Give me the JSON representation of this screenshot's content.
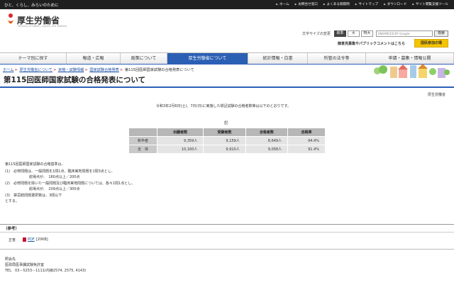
{
  "header": {
    "tagline": "ひと、くらし、みらいのために",
    "links": [
      "ホーム",
      "お問合せ窓口",
      "よくある御質問",
      "サイトマップ",
      "ダウンロード",
      "サイト閲覧支援ツール"
    ],
    "logo_title": "厚生労働省",
    "logo_sub": "Ministry of Health, Labour and Welfare",
    "fontsize_label": "文字サイズの変更",
    "fontsize_options": [
      "標準",
      "大",
      "特大"
    ],
    "search_placeholder": "ENHANCED BY Google",
    "search_button": "検索",
    "pubcomment": "御意見募集やパブリックコメントはこちら",
    "sankaku": "国民参加の場"
  },
  "nav": {
    "items": [
      "テーマ別に探す",
      "報道・広報",
      "政策について",
      "厚生労働省について",
      "統計情報・白書",
      "所管の法令等",
      "申請・募集・情報公開"
    ]
  },
  "breadcrumb": {
    "items": [
      "ホーム",
      "厚生労働省について",
      "資格・試験情報",
      "国家試験合格発表"
    ],
    "current": "第115回医師国家試験の合格発表について"
  },
  "page": {
    "title": "第115回医師国家試験の合格発表について",
    "issuer": "厚生労働省",
    "intro": "令和3年2月6日(土)、7日(日)に実施した標記試験の合格者数等は以下のとおりです。",
    "ki": "記"
  },
  "table": {
    "headers": [
      "",
      "出願者数",
      "受験者数",
      "合格者数",
      "合格率"
    ],
    "rows": [
      [
        "新卒者",
        "9,359人",
        "9,159人",
        "8,649人",
        "94.4%"
      ],
      [
        "全　体",
        "10,160人",
        "9,910人",
        "9,058人",
        "91.4%"
      ]
    ]
  },
  "criteria": {
    "head": "第115回医師国家試験の合格基準は、",
    "lines": [
      "(1)　必修問題は、一般問題を1問1点、臨床実地問題を1問3点とし、",
      "総得点が、　160点以上／200点",
      "(2)　必修問題を除いた一般問題及び臨床実地問題については、各々1問1点とし、",
      "総得点が、　209点以上／300点",
      "(3)　禁忌肢問題選択数は、3問以下"
    ],
    "tail": "とする。"
  },
  "reference": {
    "label": "（参考）",
    "item": "正答",
    "file_link": "PDF",
    "file_size": "[20KB]"
  },
  "contact": {
    "lines": [
      "照会先",
      "医政局医事課試験免許室",
      "TEL　03－5253－1111(内線2574, 2575, 4143)"
    ]
  },
  "colors": {
    "accent": "#2b5fb4",
    "logo_red": "#d9262c",
    "logo_orange": "#f29b1e",
    "pdf": "#c8102e"
  }
}
